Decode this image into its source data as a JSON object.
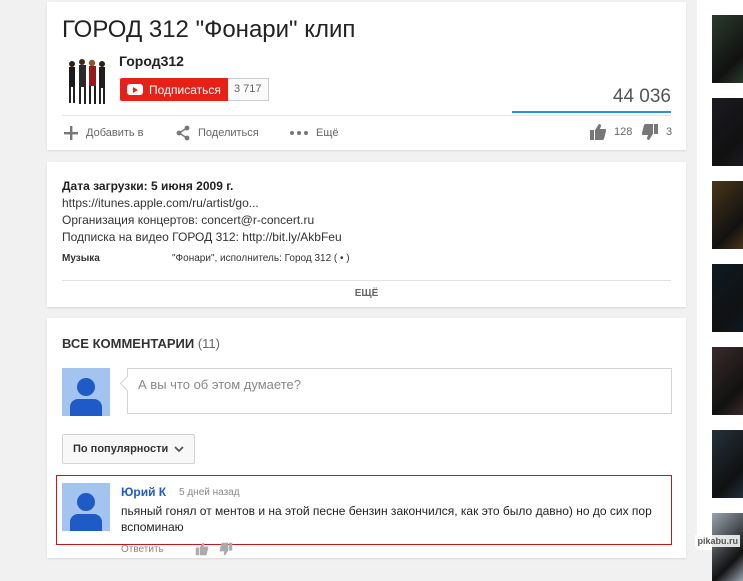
{
  "video": {
    "title": "ГОРОД 312 \"Фонари\" клип",
    "channel_name": "Город312",
    "subscribe_label": "Подписаться",
    "subscriber_count": "3 717",
    "view_count": "44 036",
    "actions": {
      "add_to": "Добавить в",
      "share": "Поделиться",
      "more": "Ещё"
    },
    "likes": "128",
    "dislikes": "3"
  },
  "description": {
    "upload_date": "Дата загрузки: 5 июня 2009 г.",
    "lines": [
      "https://itunes.apple.com/ru/artist/go...",
      "Организация концертов: concert@r-concert.ru",
      "Подписка на видео ГОРОД 312: http://bit.ly/AkbFeu"
    ],
    "meta_label": "Музыка",
    "meta_value": "\"Фонари\", исполнитель: Город 312 ( • )",
    "show_more": "ЕЩЁ"
  },
  "comments": {
    "heading": "Все комментарии",
    "count": "(11)",
    "input_placeholder": "А вы что об этом думаете?",
    "sort_label": "По популярности",
    "items": [
      {
        "author": "Юрий К",
        "time": "5 дней назад",
        "text": "пьяный гонял от ментов и на этой песне бензин закончился, как это было давно) но до сих пор вспоминаю",
        "reply": "Ответить"
      }
    ]
  },
  "sidebar": {
    "thumbnail_colors": [
      "#2a3a2c",
      "#1b1b22",
      "#4a3618",
      "#0e1a22",
      "#3a2a2a",
      "#23313b",
      "#9aa4b0"
    ]
  },
  "watermark": "pikabu.ru",
  "colors": {
    "subscribe_red": "#e62117",
    "link_blue": "#1f5bc6",
    "view_bar_blue": "#2793e6",
    "highlight_border": "#c8161d"
  }
}
